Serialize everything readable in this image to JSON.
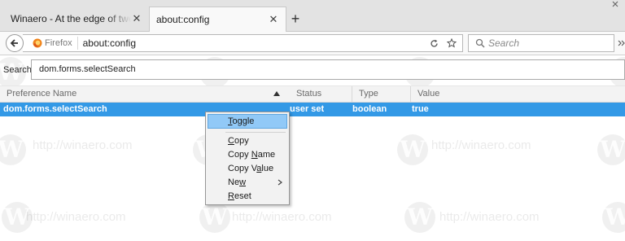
{
  "tabs": [
    {
      "title": "Winaero - At the edge of tweaking",
      "active": false
    },
    {
      "title": "about:config",
      "active": true
    }
  ],
  "navbar": {
    "identity_label": "Firefox",
    "url": "about:config",
    "search_placeholder": "Search"
  },
  "config_search": {
    "label": "Search:",
    "value": "dom.forms.selectSearch"
  },
  "columns": [
    "Preference Name",
    "Status",
    "Type",
    "Value"
  ],
  "rows": [
    {
      "name": "dom.forms.selectSearch",
      "status": "user set",
      "type": "boolean",
      "value": "true"
    }
  ],
  "context_menu": {
    "items": [
      {
        "label": "Toggle",
        "highlighted": true
      },
      {
        "label": "Copy"
      },
      {
        "label": "Copy Name"
      },
      {
        "label": "Copy Value"
      },
      {
        "label": "New",
        "has_submenu": true
      },
      {
        "label": "Reset"
      }
    ]
  },
  "watermark": {
    "text": "http://winaero.com",
    "logo_letter": "W"
  },
  "colors": {
    "selection": "#3399e6",
    "menu_highlight": "#91c9f7",
    "firefox_orange": "#f0841b"
  }
}
